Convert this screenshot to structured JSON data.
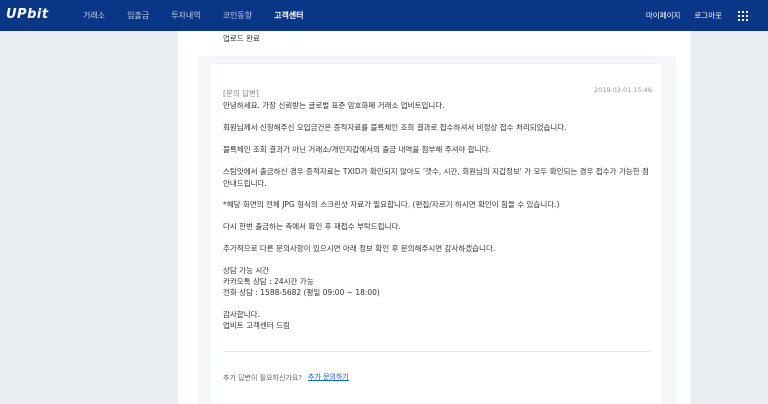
{
  "header": {
    "logo": "UPbit",
    "nav": [
      "거래소",
      "입출금",
      "투자내역",
      "코인동향",
      "고객센터"
    ],
    "active_nav": "고객센터",
    "right": {
      "mypage": "마이페이지",
      "logout": "로그아웃"
    },
    "menu_icon": "grid-icon"
  },
  "upload": {
    "status": "업로드 완료"
  },
  "answer": {
    "title": "[문의 답변]",
    "date": "2019.03.01 15:46",
    "lines": [
      "안녕하세요. 가장 신뢰받는 글로벌 표준 암호화폐 거래소 업비트입니다.",
      "회원님께서 신청해주신 오입금건은 증적자료를 블록체인 조회 결과로 접수하셔서 비정상 접수 처리되었습니다.",
      "블록체인 조회 결과가 아닌 거래소/개인지갑에서의 출금 내역을 첨부해 주셔야 합니다.",
      "스팀잇에서 출금하신 경우 증적자료는 TXID가 확인되지 않아도 '갯수, 시간, 회원님의 지갑정보' 가 모두 확인되는 경우 접수가 가능한 점",
      "안내드립니다.",
      "*해당 화면의 전체 JPG 형식의 스크린샷 자료가 필요합니다. (편집/자르기 하시면 확인이 힘들 수 있습니다.)",
      "다시 한번 출금하는 측에서 확인 후 재접수 부탁드립니다.",
      "추가적으로 다른 문의사항이 있으시면 아래 정보 확인 후 문의해주시면 감사하겠습니다.",
      "상담 가능 시간",
      "카카오톡 상담 : 24시간 가능",
      "전화 상담 : 1588-5682 (평일 09:00 ~ 18:00)",
      "감사합니다.",
      "업비트 고객센터 드림"
    ]
  },
  "footer": {
    "question": "추가 답변이 필요하신가요?",
    "link": "추가 문의하기"
  },
  "colors": {
    "header_bg": "#093687",
    "link": "#1261c4",
    "page_bg": "#e9ecf1"
  }
}
